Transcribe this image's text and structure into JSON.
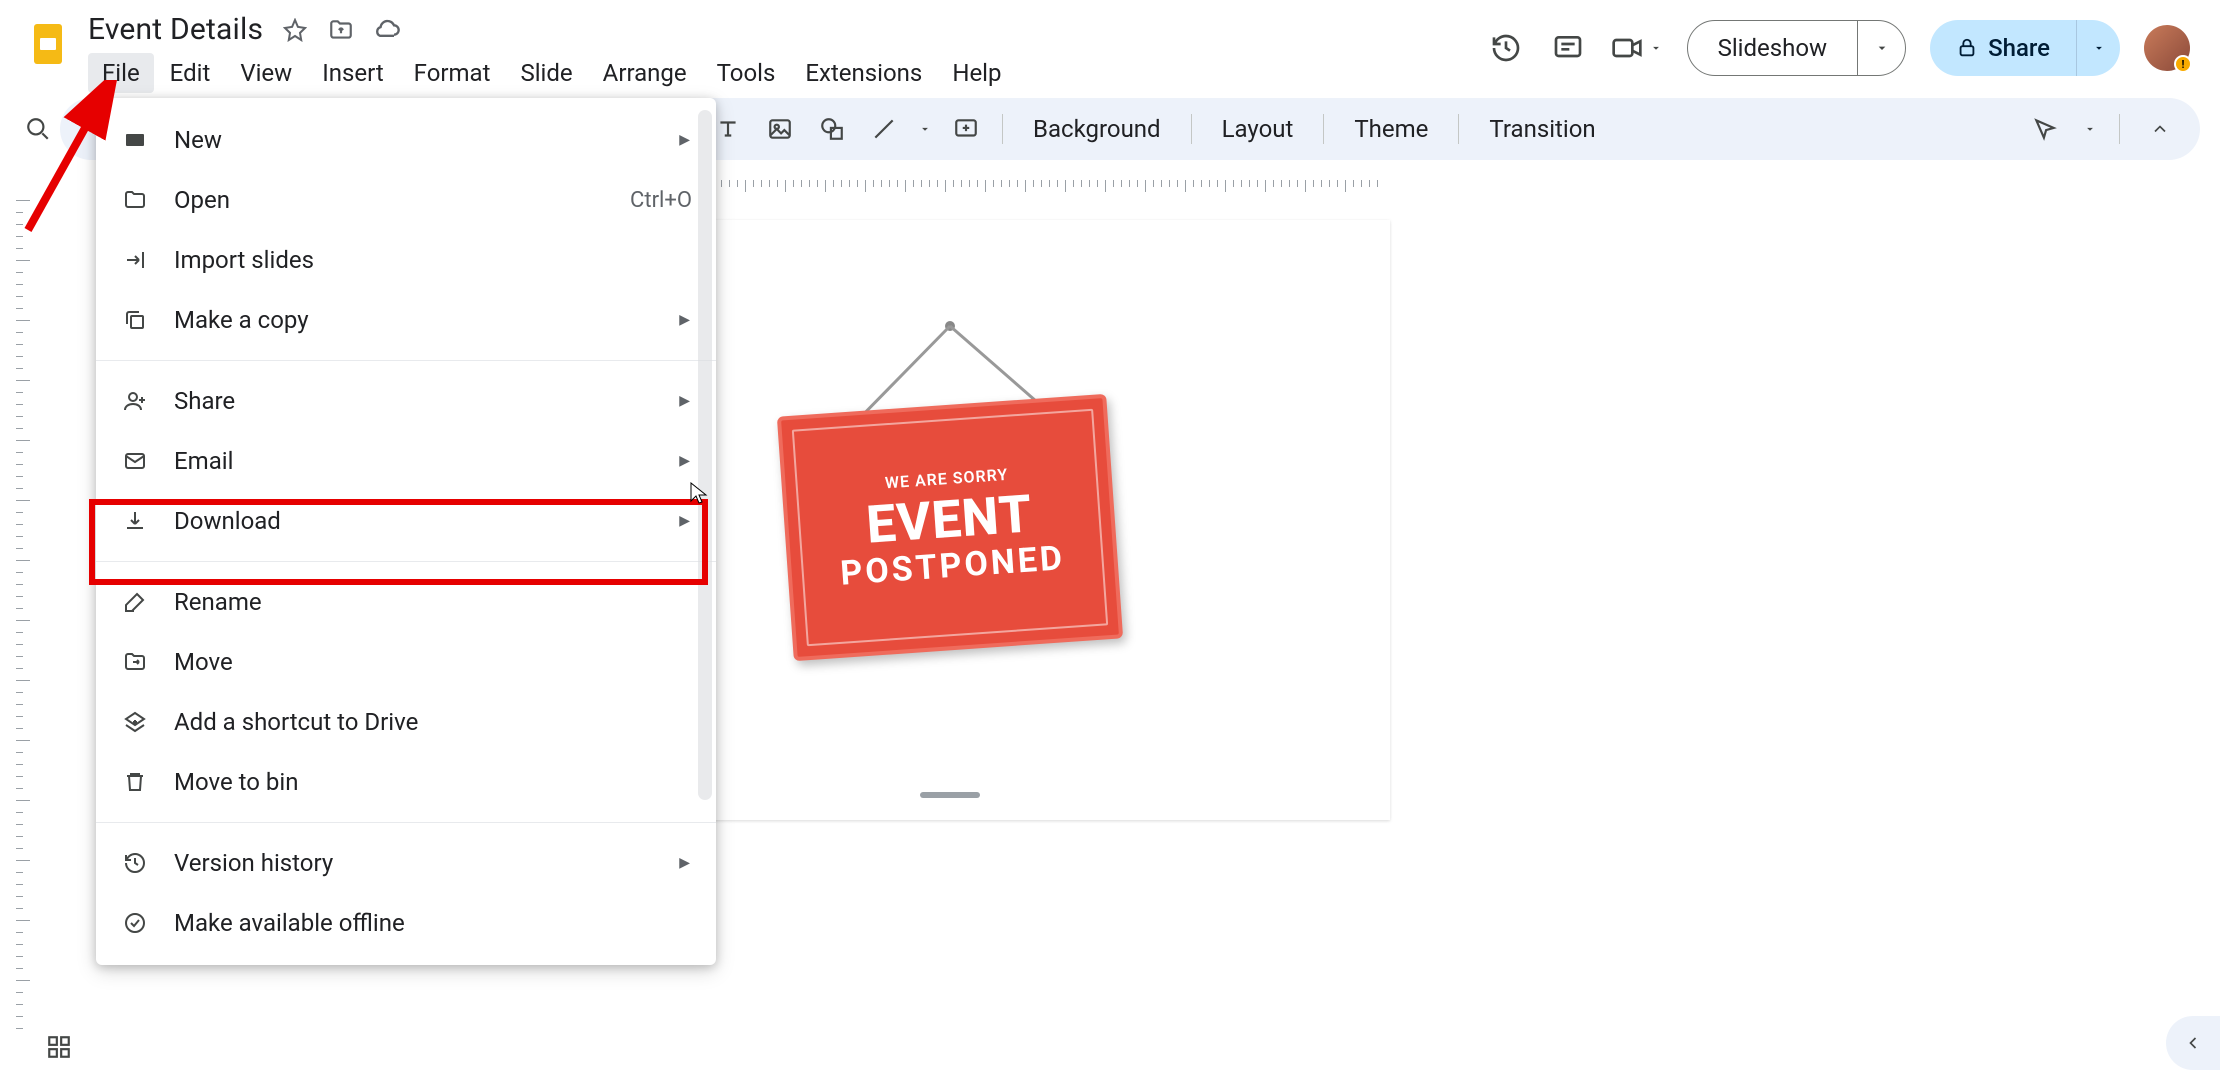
{
  "doc_title": "Event Details",
  "menubar": [
    "File",
    "Edit",
    "View",
    "Insert",
    "Format",
    "Slide",
    "Arrange",
    "Tools",
    "Extensions",
    "Help"
  ],
  "active_menu_index": 0,
  "header_right": {
    "slideshow_label": "Slideshow",
    "share_label": "Share"
  },
  "toolbar": {
    "background_label": "Background",
    "layout_label": "Layout",
    "theme_label": "Theme",
    "transition_label": "Transition"
  },
  "file_menu": {
    "items": [
      {
        "icon": "rectangle",
        "label": "New",
        "submenu": true
      },
      {
        "icon": "folder",
        "label": "Open",
        "shortcut": "Ctrl+O"
      },
      {
        "icon": "import",
        "label": "Import slides"
      },
      {
        "icon": "copy",
        "label": "Make a copy",
        "submenu": true
      },
      {
        "divider": true
      },
      {
        "icon": "person-add",
        "label": "Share",
        "submenu": true
      },
      {
        "icon": "mail",
        "label": "Email",
        "submenu": true
      },
      {
        "icon": "download",
        "label": "Download",
        "submenu": true,
        "highlighted": true
      },
      {
        "divider": true
      },
      {
        "icon": "rename",
        "label": "Rename"
      },
      {
        "icon": "move",
        "label": "Move"
      },
      {
        "icon": "shortcut",
        "label": "Add a shortcut to Drive"
      },
      {
        "icon": "trash",
        "label": "Move to bin"
      },
      {
        "divider": true
      },
      {
        "icon": "history",
        "label": "Version history",
        "submenu": true
      },
      {
        "icon": "offline",
        "label": "Make available offline"
      }
    ]
  },
  "slide_content": {
    "line1": "WE ARE SORRY",
    "line2": "EVENT",
    "line3": "POSTPONED"
  }
}
